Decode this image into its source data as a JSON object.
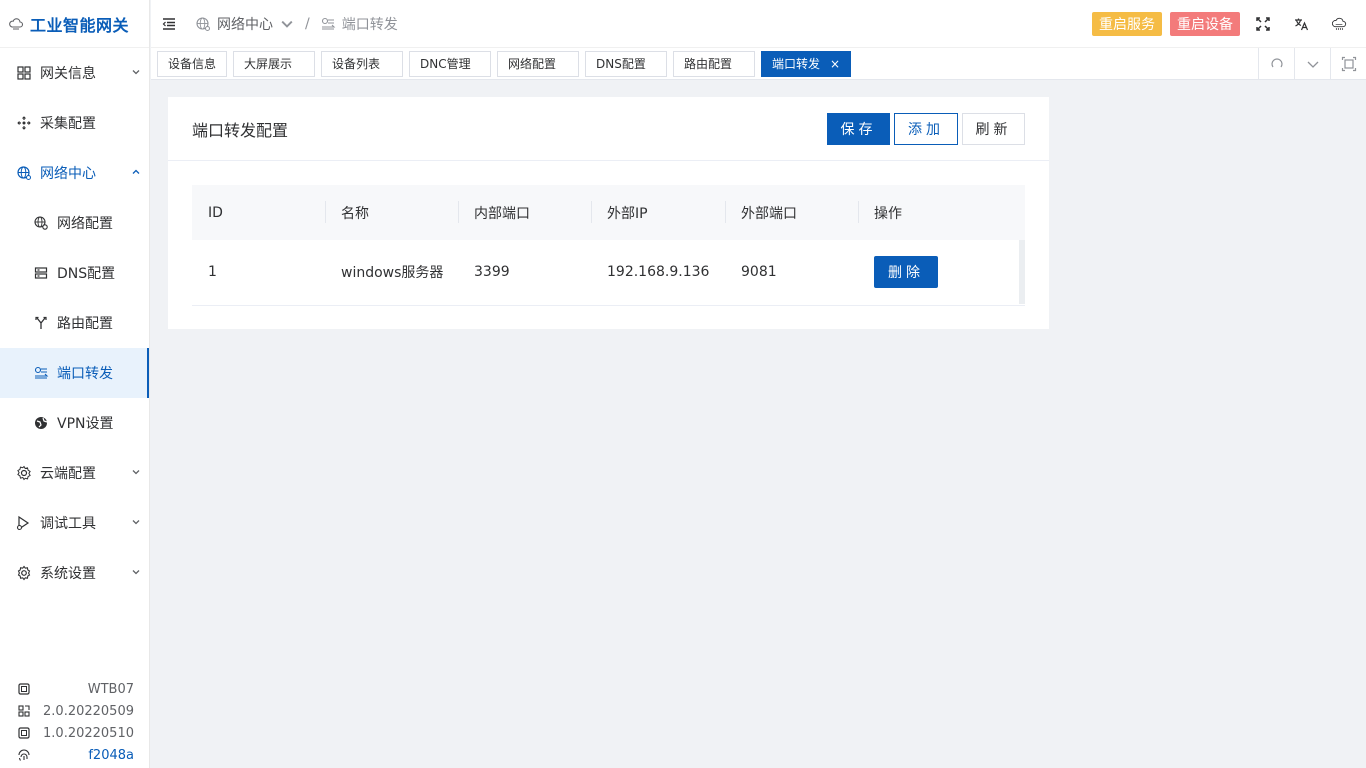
{
  "app": {
    "title": "工业智能网关"
  },
  "sidebar": {
    "items": [
      {
        "label": "网关信息",
        "icon": "grid-icon",
        "has_arrow": true
      },
      {
        "label": "采集配置",
        "icon": "collect-icon",
        "has_arrow": false
      },
      {
        "label": "网络中心",
        "icon": "network-icon",
        "has_arrow": true,
        "expanded": true,
        "children": [
          {
            "label": "网络配置",
            "icon": "network-config-icon"
          },
          {
            "label": "DNS配置",
            "icon": "dns-icon"
          },
          {
            "label": "路由配置",
            "icon": "route-icon"
          },
          {
            "label": "端口转发",
            "icon": "port-forward-icon",
            "active": true
          },
          {
            "label": "VPN设置",
            "icon": "vpn-icon"
          }
        ]
      },
      {
        "label": "云端配置",
        "icon": "cloud-gear-icon",
        "has_arrow": true
      },
      {
        "label": "调试工具",
        "icon": "debug-icon",
        "has_arrow": true
      },
      {
        "label": "系统设置",
        "icon": "settings-icon",
        "has_arrow": true
      }
    ],
    "sysinfo": {
      "model": "WTB07",
      "version1": "2.0.20220509",
      "version2": "1.0.20220510",
      "id": "f2048a"
    }
  },
  "header": {
    "breadcrumb_parent": "网络中心",
    "breadcrumb_current": "端口转发",
    "restart_service": "重启服务",
    "restart_device": "重启设备"
  },
  "tabs": [
    "设备信息",
    "大屏展示",
    "设备列表",
    "DNC管理",
    "网络配置",
    "DNS配置",
    "路由配置",
    "端口转发"
  ],
  "active_tab": "端口转发",
  "card": {
    "title": "端口转发配置",
    "save_label": "保存",
    "add_label": "添加",
    "refresh_label": "刷新"
  },
  "table": {
    "headers": [
      "ID",
      "名称",
      "内部端口",
      "外部IP",
      "外部端口",
      "操作"
    ],
    "rows": [
      {
        "id": "1",
        "name": "windows服务器",
        "internal_port": "3399",
        "external_ip": "192.168.9.136",
        "external_port": "9081",
        "action": "删除"
      }
    ]
  },
  "colors": {
    "primary": "#0a5db8",
    "warning": "#f5bc45",
    "danger": "#f37b7b"
  }
}
